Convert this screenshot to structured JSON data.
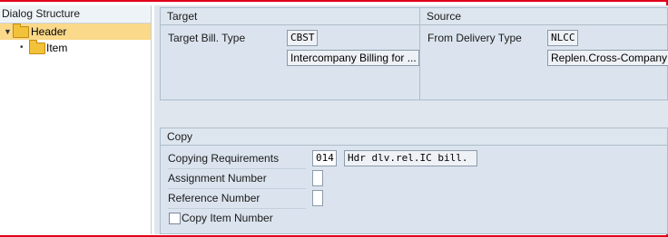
{
  "dialog_structure": {
    "title": "Dialog Structure",
    "items": [
      {
        "label": "Header",
        "selected": true,
        "expanded": true
      },
      {
        "label": "Item",
        "selected": false
      }
    ]
  },
  "target": {
    "title": "Target",
    "bill_type_label": "Target Bill. Type",
    "bill_type_value": "CBST",
    "bill_type_desc": "Intercompany Billing for ..."
  },
  "source": {
    "title": "Source",
    "delivery_type_label": "From Delivery Type",
    "delivery_type_value": "NLCC",
    "delivery_type_desc": "Replen.Cross-Company"
  },
  "copy": {
    "title": "Copy",
    "copying_req_label": "Copying Requirements",
    "copying_req_value": "014",
    "copying_req_desc": "Hdr dlv.rel.IC bill.",
    "assignment_label": "Assignment Number",
    "assignment_value": "",
    "reference_label": "Reference Number",
    "reference_value": "",
    "copy_item_label": "Copy Item Number",
    "copy_item_checked": false
  },
  "colors": {
    "selection": "#fad98a",
    "frame_border": "#e0001a",
    "panel_bg": "#dde6ef"
  }
}
